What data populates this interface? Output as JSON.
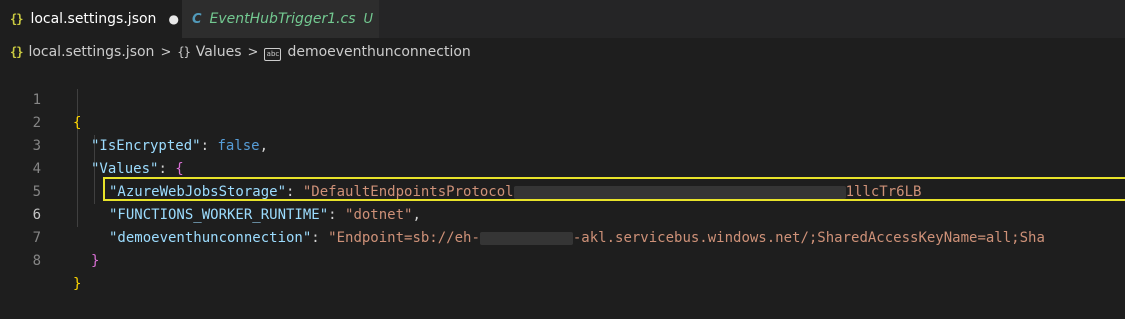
{
  "tabs": [
    {
      "icon": "{}",
      "label": "local.settings.json",
      "dirty_marker": "●"
    },
    {
      "icon": "C",
      "label": "EventHubTrigger1.cs",
      "git_status": "U"
    }
  ],
  "breadcrumb": {
    "items": [
      {
        "icon": "{}",
        "label": "local.settings.json"
      },
      {
        "icon": "{}",
        "label": "Values"
      },
      {
        "icon": "abc",
        "label": "demoeventhunconnection"
      }
    ],
    "separator": ">"
  },
  "editor": {
    "current_line": 6,
    "lines": [
      {
        "number": "1",
        "open": "{"
      },
      {
        "number": "2",
        "key": "\"IsEncrypted\"",
        "colon": ": ",
        "value": "false",
        "comma": ","
      },
      {
        "number": "3",
        "key": "\"Values\"",
        "colon": ": ",
        "brace": "{"
      },
      {
        "number": "4",
        "key": "\"AzureWebJobsStorage\"",
        "colon": ": ",
        "value_start": "\"DefaultEndpointsProtocol",
        "value_end": "1llcTr6LB"
      },
      {
        "number": "5",
        "key": "\"FUNCTIONS_WORKER_RUNTIME\"",
        "colon": ": ",
        "value": "\"dotnet\"",
        "comma": ","
      },
      {
        "number": "6",
        "key": "\"demoeventhunconnection\"",
        "colon": ": ",
        "value_start": "\"Endpoint=sb://eh-",
        "value_end": "-akl.servicebus.windows.net/;SharedAccessKeyName=all;Sha"
      },
      {
        "number": "7",
        "close": "}"
      },
      {
        "number": "8",
        "close": "}"
      }
    ]
  }
}
